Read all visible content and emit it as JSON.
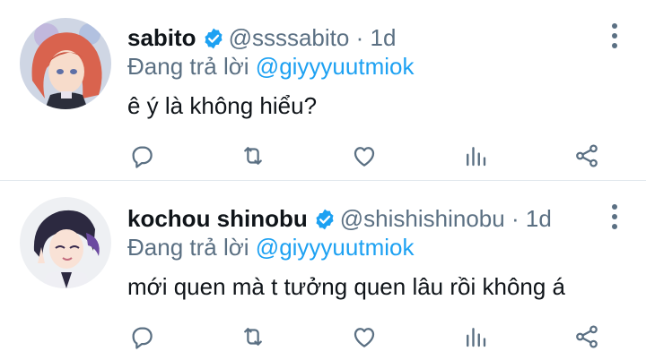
{
  "tweets": [
    {
      "name": "sabito",
      "handle": "@ssssabito",
      "dot": "·",
      "time": "1d",
      "replying_prefix": "Đang trả lời",
      "replying_to": "@giyyyuutmiok",
      "text": "ê ý là không hiểu?"
    },
    {
      "name": "kochou shinobu",
      "handle": "@shishishinobu",
      "dot": "·",
      "time": "1d",
      "replying_prefix": "Đang trả lời",
      "replying_to": "@giyyyuutmiok",
      "text": "mới quen mà t tưởng quen lâu rồi không á"
    }
  ],
  "icons": {
    "verified": "verified-badge-icon",
    "more": "more-vertical-icon",
    "reply": "reply-icon",
    "retweet": "retweet-icon",
    "like": "like-icon",
    "views": "views-icon",
    "share": "share-icon"
  },
  "colors": {
    "name": "#0f1419",
    "secondary": "#5b7083",
    "accent": "#1da1f2",
    "divider": "#e1e8ed",
    "avatar1_hair": "#d9634e",
    "avatar2_hair": "#4a3a6e"
  }
}
